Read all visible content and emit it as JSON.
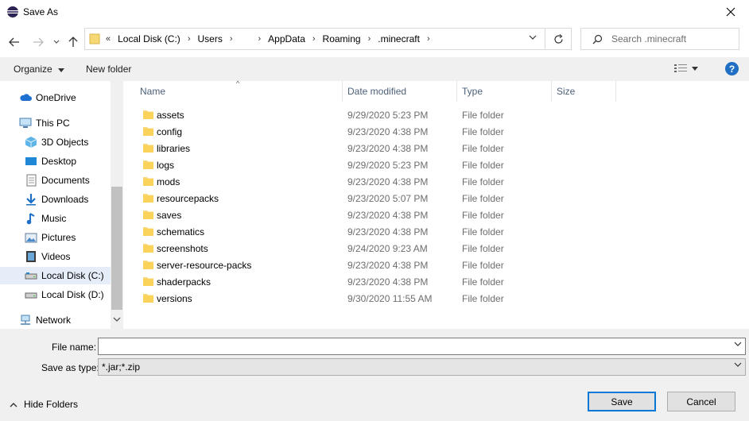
{
  "window": {
    "title": "Save As"
  },
  "address": {
    "crumbs": [
      "Local Disk (C:)",
      "Users",
      "",
      "AppData",
      "Roaming",
      ".minecraft"
    ],
    "overflow": "«"
  },
  "search": {
    "placeholder": "Search .minecraft"
  },
  "toolbar": {
    "organize": "Organize",
    "new_folder": "New folder"
  },
  "nav": {
    "items": [
      {
        "label": "OneDrive",
        "icon": "cloud-icon"
      },
      {
        "label": "This PC",
        "icon": "computer-icon"
      },
      {
        "label": "3D Objects",
        "icon": "cube-icon"
      },
      {
        "label": "Desktop",
        "icon": "desktop-icon"
      },
      {
        "label": "Documents",
        "icon": "document-icon"
      },
      {
        "label": "Downloads",
        "icon": "download-icon"
      },
      {
        "label": "Music",
        "icon": "music-icon"
      },
      {
        "label": "Pictures",
        "icon": "picture-icon"
      },
      {
        "label": "Videos",
        "icon": "video-icon"
      },
      {
        "label": "Local Disk (C:)",
        "icon": "drive-icon",
        "selected": true
      },
      {
        "label": "Local Disk (D:)",
        "icon": "drive-icon"
      },
      {
        "label": "Network",
        "icon": "network-icon"
      }
    ]
  },
  "columns": {
    "name": "Name",
    "date": "Date modified",
    "type": "Type",
    "size": "Size"
  },
  "files": [
    {
      "name": "assets",
      "date": "9/29/2020 5:23 PM",
      "type": "File folder"
    },
    {
      "name": "config",
      "date": "9/23/2020 4:38 PM",
      "type": "File folder"
    },
    {
      "name": "libraries",
      "date": "9/23/2020 4:38 PM",
      "type": "File folder"
    },
    {
      "name": "logs",
      "date": "9/29/2020 5:23 PM",
      "type": "File folder"
    },
    {
      "name": "mods",
      "date": "9/23/2020 4:38 PM",
      "type": "File folder"
    },
    {
      "name": "resourcepacks",
      "date": "9/23/2020 5:07 PM",
      "type": "File folder"
    },
    {
      "name": "saves",
      "date": "9/23/2020 4:38 PM",
      "type": "File folder"
    },
    {
      "name": "schematics",
      "date": "9/23/2020 4:38 PM",
      "type": "File folder"
    },
    {
      "name": "screenshots",
      "date": "9/24/2020 9:23 AM",
      "type": "File folder"
    },
    {
      "name": "server-resource-packs",
      "date": "9/23/2020 4:38 PM",
      "type": "File folder"
    },
    {
      "name": "shaderpacks",
      "date": "9/23/2020 4:38 PM",
      "type": "File folder"
    },
    {
      "name": "versions",
      "date": "9/30/2020 11:55 AM",
      "type": "File folder"
    }
  ],
  "form": {
    "file_name_label": "File name:",
    "file_name_value": "",
    "save_type_label": "Save as type:",
    "save_type_value": "*.jar;*.zip"
  },
  "footer": {
    "hide_folders": "Hide Folders",
    "save": "Save",
    "cancel": "Cancel"
  },
  "colors": {
    "accent": "#0078d7",
    "folder": "#f8d775",
    "selected_bg": "#e5eef8"
  }
}
